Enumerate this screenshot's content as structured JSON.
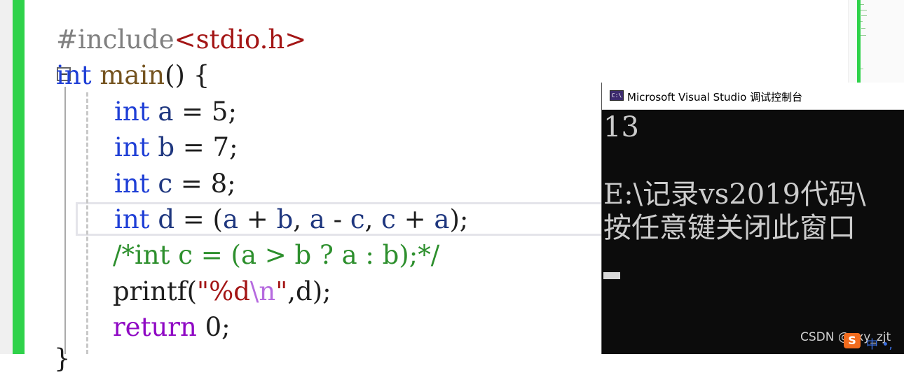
{
  "code": {
    "line1": {
      "preprocessor": "#include",
      "header": "<stdio.h>"
    },
    "line2": {
      "type": "int",
      "func": "main",
      "rest": "() {"
    },
    "line3": {
      "type": "int",
      "name": "a",
      "eq": " = ",
      "value": "5",
      "end": ";"
    },
    "line4": {
      "type": "int",
      "name": "b",
      "eq": " = ",
      "value": "7",
      "end": ";"
    },
    "line5": {
      "type": "int",
      "name": "c",
      "eq": " = ",
      "value": "8",
      "end": ";"
    },
    "line6": {
      "type": "int",
      "name": "d",
      "rest": " = (",
      "a1": "a",
      "op1": " + ",
      "b1": "b",
      "sep1": ", ",
      "a2": "a",
      "op2": " - ",
      "c1": "c",
      "sep2": ", ",
      "c2": "c",
      "op3": " + ",
      "a3": "a",
      "end": ");"
    },
    "line7": {
      "comment": "/*int c = (a > b ? a : b);*/"
    },
    "line8": {
      "func": "printf",
      "open": "(",
      "str1": "\"%d",
      "esc": "\\n",
      "str2": "\"",
      "args": ",d);"
    },
    "line9": {
      "keyword": "return",
      "value": " 0;"
    },
    "line10": {
      "brace": "}"
    }
  },
  "console": {
    "title": "Microsoft Visual Studio 调试控制台",
    "icon": "C:\\",
    "output_line1": "13",
    "output_line2": "E:\\记录vs2019代码\\",
    "output_line3": "按任意键关闭此窗口"
  },
  "overlay": {
    "watermark": "CSDN @cxy_zjt",
    "ime_badge": "S",
    "ime_text": "中 •,"
  }
}
